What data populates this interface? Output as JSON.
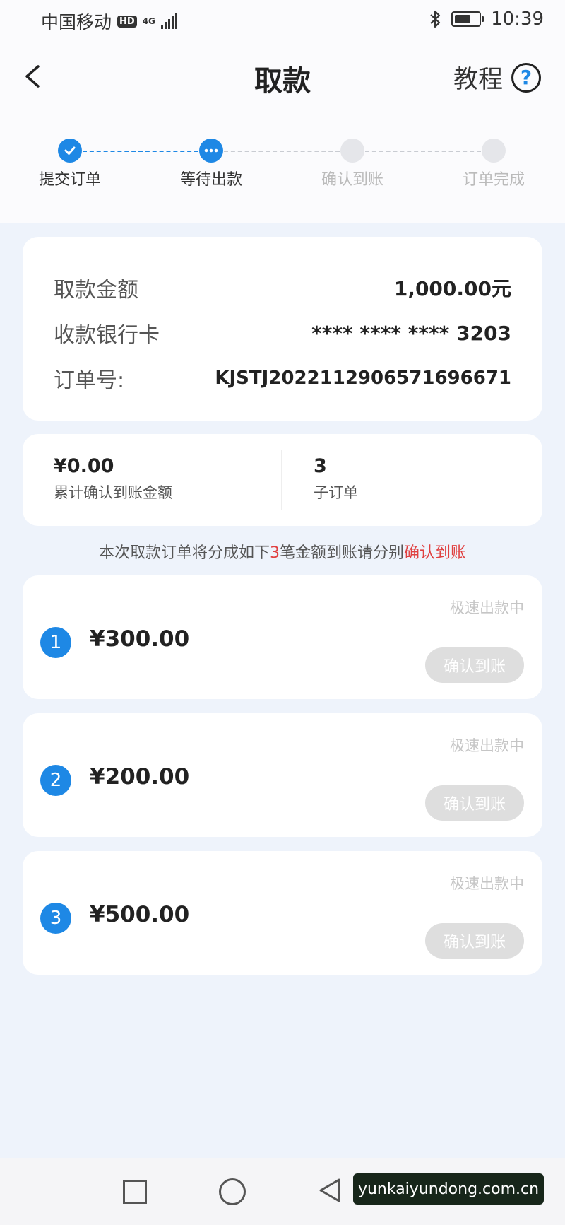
{
  "status_bar": {
    "carrier": "中国移动",
    "hd": "HD",
    "network": "4G",
    "time": "10:39"
  },
  "header": {
    "title": "取款",
    "tutorial": "教程",
    "help": "?"
  },
  "steps": [
    {
      "label": "提交订单",
      "state": "done"
    },
    {
      "label": "等待出款",
      "state": "current"
    },
    {
      "label": "确认到账",
      "state": "pending"
    },
    {
      "label": "订单完成",
      "state": "pending"
    }
  ],
  "summary": {
    "amount_label": "取款金额",
    "amount_value": "1,000.00元",
    "card_label": "收款银行卡",
    "card_value": "**** **** **** 3203",
    "order_label": "订单号:",
    "order_value": "KJSTJ2022112906571696671"
  },
  "stats": {
    "confirmed_amount": "¥0.00",
    "confirmed_label": "累计确认到账金额",
    "sub_count": "3",
    "sub_label": "子订单"
  },
  "notice": {
    "prefix": "本次取款订单将分成如下",
    "count": "3",
    "middle": "笔金额到账请分别",
    "link": "确认到账"
  },
  "sub_orders": [
    {
      "index": "1",
      "amount": "¥300.00",
      "status": "极速出款中",
      "button": "确认到账"
    },
    {
      "index": "2",
      "amount": "¥200.00",
      "status": "极速出款中",
      "button": "确认到账"
    },
    {
      "index": "3",
      "amount": "¥500.00",
      "status": "极速出款中",
      "button": "确认到账"
    }
  ],
  "watermark": "yunkaiyundong.com.cn",
  "colors": {
    "accent": "#1e88e5",
    "highlight": "#e04040",
    "disabled_button": "#dedede"
  }
}
